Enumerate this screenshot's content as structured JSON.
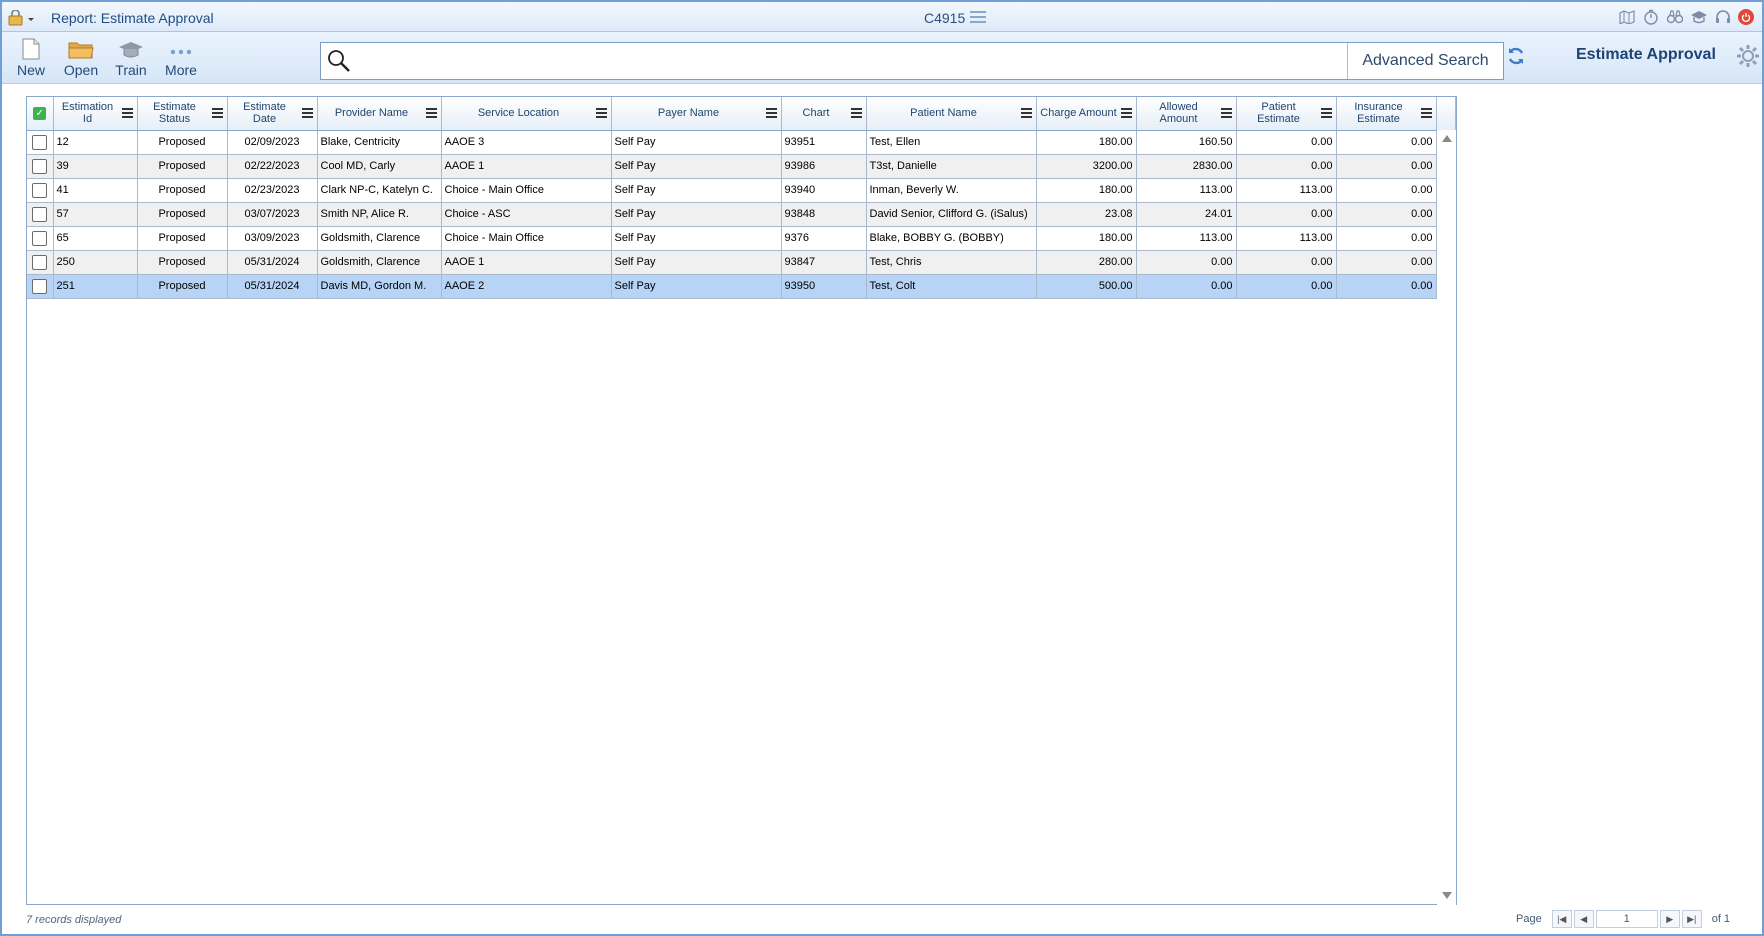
{
  "titlebar": {
    "title": "Report: Estimate Approval",
    "center_code": "C4915"
  },
  "toolbar": {
    "new_label": "New",
    "open_label": "Open",
    "train_label": "Train",
    "more_label": "More",
    "search_value": "",
    "advanced_search_label": "Advanced Search",
    "page_title": "Estimate Approval"
  },
  "grid": {
    "columns": [
      "Estimation Id",
      "Estimate Status",
      "Estimate Date",
      "Provider Name",
      "Service Location",
      "Payer Name",
      "Chart",
      "Patient Name",
      "Charge Amount",
      "Allowed Amount",
      "Patient Estimate",
      "Insurance Estimate"
    ],
    "rows": [
      {
        "id": "12",
        "status": "Proposed",
        "date": "02/09/2023",
        "provider": "Blake, Centricity",
        "location": "AAOE 3",
        "payer": "Self Pay",
        "chart": "93951",
        "patient": "Test, Ellen",
        "charge": "180.00",
        "allowed": "160.50",
        "patient_est": "0.00",
        "ins_est": "0.00"
      },
      {
        "id": "39",
        "status": "Proposed",
        "date": "02/22/2023",
        "provider": "Cool MD, Carly",
        "location": "AAOE 1",
        "payer": "Self Pay",
        "chart": "93986",
        "patient": "T3st, Danielle",
        "charge": "3200.00",
        "allowed": "2830.00",
        "patient_est": "0.00",
        "ins_est": "0.00"
      },
      {
        "id": "41",
        "status": "Proposed",
        "date": "02/23/2023",
        "provider": "Clark NP-C, Katelyn C.",
        "location": "Choice - Main Office",
        "payer": "Self Pay",
        "chart": "93940",
        "patient": "Inman, Beverly W.",
        "charge": "180.00",
        "allowed": "113.00",
        "patient_est": "113.00",
        "ins_est": "0.00"
      },
      {
        "id": "57",
        "status": "Proposed",
        "date": "03/07/2023",
        "provider": "Smith NP, Alice R.",
        "location": "Choice - ASC",
        "payer": "Self Pay",
        "chart": "93848",
        "patient": "David Senior, Clifford G. (iSalus)",
        "charge": "23.08",
        "allowed": "24.01",
        "patient_est": "0.00",
        "ins_est": "0.00"
      },
      {
        "id": "65",
        "status": "Proposed",
        "date": "03/09/2023",
        "provider": "Goldsmith, Clarence",
        "location": "Choice - Main Office",
        "payer": "Self Pay",
        "chart": "9376",
        "patient": "Blake, BOBBY G. (BOBBY)",
        "charge": "180.00",
        "allowed": "113.00",
        "patient_est": "113.00",
        "ins_est": "0.00"
      },
      {
        "id": "250",
        "status": "Proposed",
        "date": "05/31/2024",
        "provider": "Goldsmith, Clarence",
        "location": "AAOE 1",
        "payer": "Self Pay",
        "chart": "93847",
        "patient": "Test, Chris",
        "charge": "280.00",
        "allowed": "0.00",
        "patient_est": "0.00",
        "ins_est": "0.00"
      },
      {
        "id": "251",
        "status": "Proposed",
        "date": "05/31/2024",
        "provider": "Davis MD, Gordon M.",
        "location": "AAOE 2",
        "payer": "Self Pay",
        "chart": "93950",
        "patient": "Test, Colt",
        "charge": "500.00",
        "allowed": "0.00",
        "patient_est": "0.00",
        "ins_est": "0.00"
      }
    ],
    "selected_row": 6
  },
  "footer": {
    "records_text": "7 records displayed",
    "page_label": "Page",
    "page_value": "1",
    "of_label": "of 1"
  },
  "colors": {
    "accent": "#1e4475",
    "selected_row": "#b7d4f6",
    "check_green": "#3cb44b",
    "power_red": "#e0483b"
  },
  "icons": [
    "lock-icon",
    "map-icon",
    "stopwatch-icon",
    "binoculars-icon",
    "graduation-cap-icon",
    "headset-icon",
    "power-icon",
    "new-document-icon",
    "folder-icon",
    "more-dots-icon",
    "search-icon",
    "refresh-icon",
    "gear-icon"
  ]
}
